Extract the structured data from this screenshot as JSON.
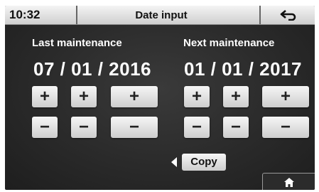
{
  "header": {
    "time": "10:32",
    "title": "Date input",
    "back_icon": "return-arrow-icon"
  },
  "last": {
    "label": "Last maintenance",
    "date": "07 / 01 / 2016"
  },
  "next": {
    "label": "Next maintenance",
    "date": "01 / 01 / 2017"
  },
  "buttons": {
    "plus": "+",
    "minus": "−"
  },
  "copy": {
    "label": "Copy",
    "arrow_icon": "left-triangle-icon"
  },
  "footer": {
    "home_icon": "home-icon"
  }
}
